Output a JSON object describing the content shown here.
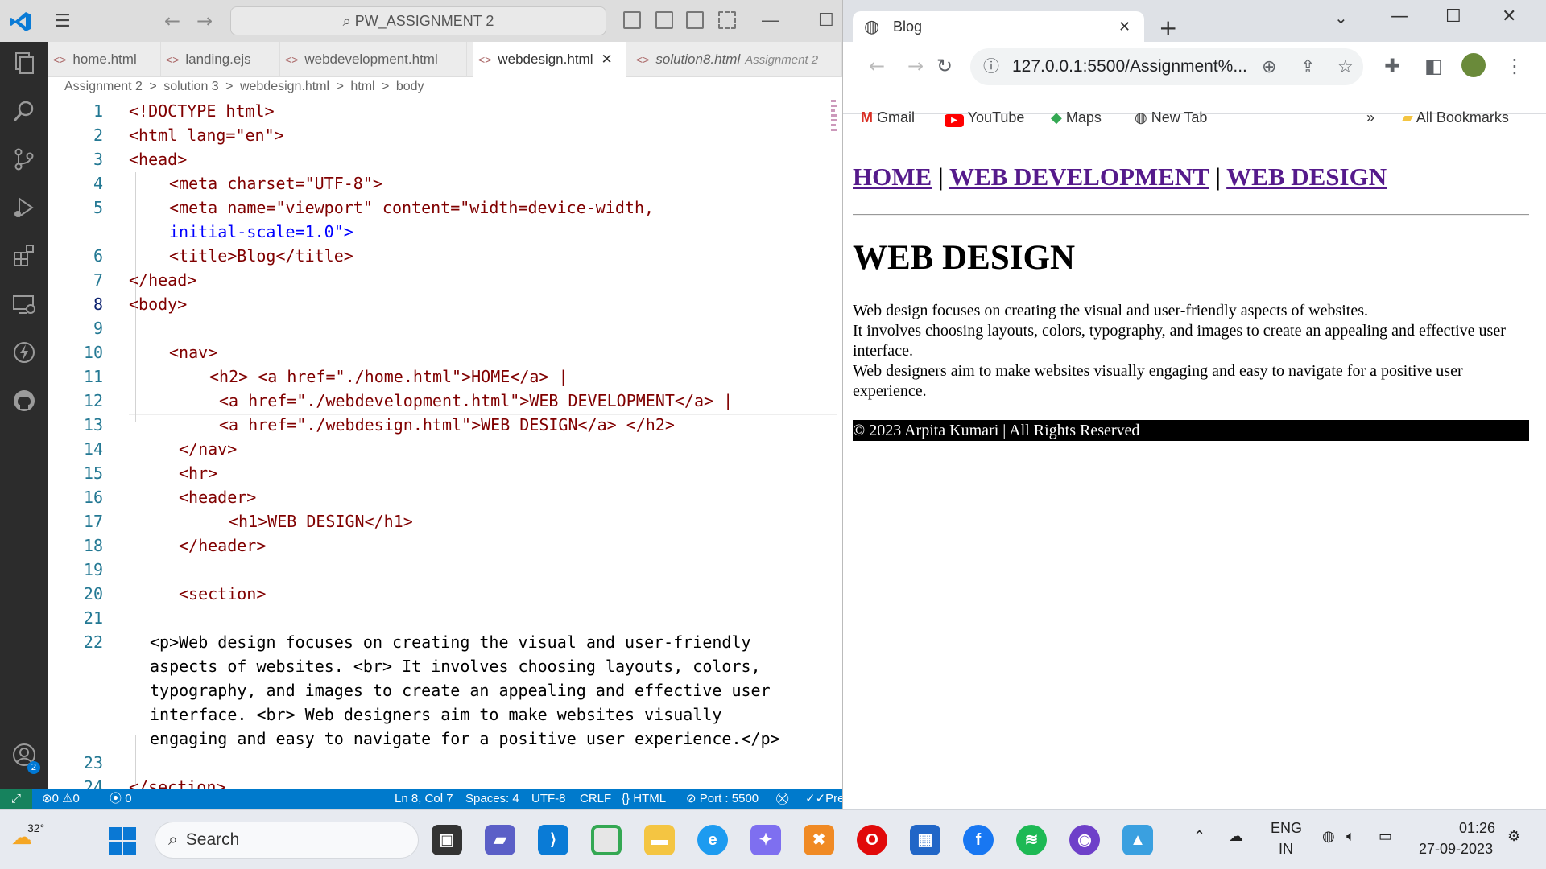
{
  "vscode": {
    "search_label": "PW_ASSIGNMENT 2",
    "tabs": [
      {
        "label": "home.html",
        "desc": ""
      },
      {
        "label": "landing.ejs",
        "desc": ""
      },
      {
        "label": "webdevelopment.html",
        "desc": ""
      },
      {
        "label": "webdesign.html",
        "desc": ""
      },
      {
        "label": "solution8.html",
        "desc": "Assignment 2"
      }
    ],
    "breadcrumb": [
      "Assignment 2",
      ">",
      "solution 3",
      ">",
      "webdesign.html",
      ">",
      "html",
      ">",
      "body"
    ],
    "line_numbers": [
      "1",
      "2",
      "3",
      "4",
      "5",
      "6",
      "7",
      "8",
      "9",
      "10",
      "11",
      "12",
      "13",
      "14",
      "15",
      "16",
      "17",
      "18",
      "19",
      "20",
      "21",
      "22",
      "23",
      "24"
    ],
    "code": {
      "l1": "<!DOCTYPE html>",
      "l2": "<html lang=\"en\">",
      "l3": "<head>",
      "l4": "<meta charset=\"UTF-8\">",
      "l5a": "<meta name=\"viewport\" content=\"width=device-width,",
      "l5b": "initial-scale=1.0\">",
      "l6": "<title>Blog</title>",
      "l7": "</head>",
      "l8": "<body>",
      "l10": "<nav>",
      "l11": "<h2> <a href=\"./home.html\">HOME</a> |",
      "l12": "<a href=\"./webdevelopment.html\">WEB DEVELOPMENT</a> |",
      "l13": "<a href=\"./webdesign.html\">WEB DESIGN</a> </h2>",
      "l14": "</nav>",
      "l15": "<hr>",
      "l16": "<header>",
      "l17": "<h1>WEB DESIGN</h1>",
      "l18": "</header>",
      "l20": "<section>",
      "l22a": "<p>Web design focuses on creating the visual and user-friendly",
      "l22b": "aspects of websites. <br> It involves choosing layouts, colors,",
      "l22c": "typography, and images to create an appealing and effective user",
      "l22d": "interface. <br> Web designers aim to make websites visually",
      "l22e": "engaging and easy to navigate for a positive user experience.</p>",
      "l24": "</section>"
    },
    "status": {
      "errors": "0",
      "warnings": "0",
      "ports": "0",
      "position": "Ln 8, Col 7",
      "spaces": "Spaces: 4",
      "encoding": "UTF-8",
      "eol": "CRLF",
      "language": "HTML",
      "port": "Port : 5500",
      "prettier": "Pre"
    },
    "account_badge": "2"
  },
  "chrome": {
    "tab_title": "Blog",
    "url": "127.0.0.1:5500/Assignment%...",
    "bookmarks": [
      "Gmail",
      "YouTube",
      "Maps",
      "New Tab"
    ],
    "all_bookmarks": "All Bookmarks",
    "overflow": "»",
    "page": {
      "nav_home": "HOME",
      "nav_sep": "|",
      "nav_webdev": "WEB DEVELOPMENT",
      "nav_webdesign": "WEB DESIGN",
      "heading": "WEB DESIGN",
      "p1": "Web design focuses on creating the visual and user-friendly aspects of websites.",
      "p2": "It involves choosing layouts, colors, typography, and images to create an appealing and effective user interface.",
      "p3": "Web designers aim to make websites visually engaging and easy to navigate for a positive user experience.",
      "footer": "© 2023 Arpita Kumari | All Rights Reserved"
    }
  },
  "taskbar": {
    "weather": "32°",
    "search_label": "Search",
    "lang_top": "ENG",
    "lang_bottom": "IN",
    "time": "01:26",
    "date": "27-09-2023"
  },
  "colors": {
    "vscode_blue": "#007acc",
    "link_purple": "#551a8b",
    "tag": "#800000",
    "attr": "#e50000",
    "string": "#0000ff"
  }
}
